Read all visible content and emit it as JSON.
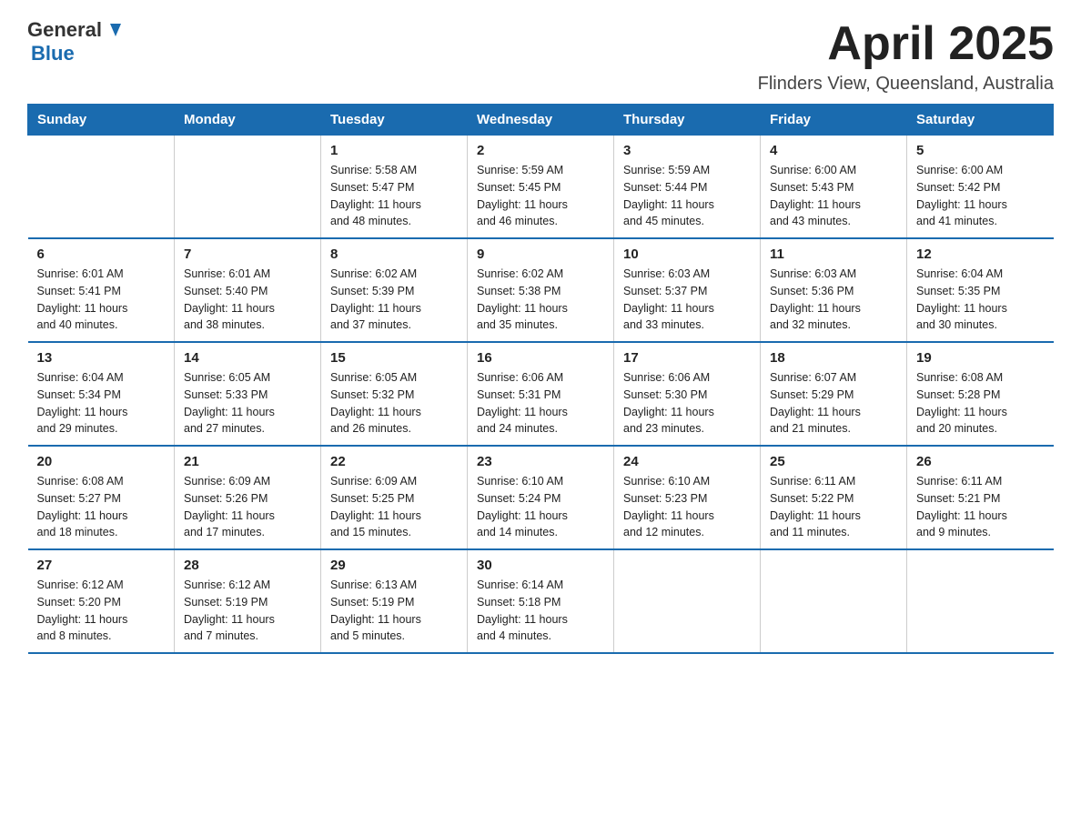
{
  "header": {
    "logo_general": "General",
    "logo_blue": "Blue",
    "month_title": "April 2025",
    "location": "Flinders View, Queensland, Australia"
  },
  "weekdays": [
    "Sunday",
    "Monday",
    "Tuesday",
    "Wednesday",
    "Thursday",
    "Friday",
    "Saturday"
  ],
  "weeks": [
    [
      {
        "day": "",
        "info": ""
      },
      {
        "day": "",
        "info": ""
      },
      {
        "day": "1",
        "info": "Sunrise: 5:58 AM\nSunset: 5:47 PM\nDaylight: 11 hours\nand 48 minutes."
      },
      {
        "day": "2",
        "info": "Sunrise: 5:59 AM\nSunset: 5:45 PM\nDaylight: 11 hours\nand 46 minutes."
      },
      {
        "day": "3",
        "info": "Sunrise: 5:59 AM\nSunset: 5:44 PM\nDaylight: 11 hours\nand 45 minutes."
      },
      {
        "day": "4",
        "info": "Sunrise: 6:00 AM\nSunset: 5:43 PM\nDaylight: 11 hours\nand 43 minutes."
      },
      {
        "day": "5",
        "info": "Sunrise: 6:00 AM\nSunset: 5:42 PM\nDaylight: 11 hours\nand 41 minutes."
      }
    ],
    [
      {
        "day": "6",
        "info": "Sunrise: 6:01 AM\nSunset: 5:41 PM\nDaylight: 11 hours\nand 40 minutes."
      },
      {
        "day": "7",
        "info": "Sunrise: 6:01 AM\nSunset: 5:40 PM\nDaylight: 11 hours\nand 38 minutes."
      },
      {
        "day": "8",
        "info": "Sunrise: 6:02 AM\nSunset: 5:39 PM\nDaylight: 11 hours\nand 37 minutes."
      },
      {
        "day": "9",
        "info": "Sunrise: 6:02 AM\nSunset: 5:38 PM\nDaylight: 11 hours\nand 35 minutes."
      },
      {
        "day": "10",
        "info": "Sunrise: 6:03 AM\nSunset: 5:37 PM\nDaylight: 11 hours\nand 33 minutes."
      },
      {
        "day": "11",
        "info": "Sunrise: 6:03 AM\nSunset: 5:36 PM\nDaylight: 11 hours\nand 32 minutes."
      },
      {
        "day": "12",
        "info": "Sunrise: 6:04 AM\nSunset: 5:35 PM\nDaylight: 11 hours\nand 30 minutes."
      }
    ],
    [
      {
        "day": "13",
        "info": "Sunrise: 6:04 AM\nSunset: 5:34 PM\nDaylight: 11 hours\nand 29 minutes."
      },
      {
        "day": "14",
        "info": "Sunrise: 6:05 AM\nSunset: 5:33 PM\nDaylight: 11 hours\nand 27 minutes."
      },
      {
        "day": "15",
        "info": "Sunrise: 6:05 AM\nSunset: 5:32 PM\nDaylight: 11 hours\nand 26 minutes."
      },
      {
        "day": "16",
        "info": "Sunrise: 6:06 AM\nSunset: 5:31 PM\nDaylight: 11 hours\nand 24 minutes."
      },
      {
        "day": "17",
        "info": "Sunrise: 6:06 AM\nSunset: 5:30 PM\nDaylight: 11 hours\nand 23 minutes."
      },
      {
        "day": "18",
        "info": "Sunrise: 6:07 AM\nSunset: 5:29 PM\nDaylight: 11 hours\nand 21 minutes."
      },
      {
        "day": "19",
        "info": "Sunrise: 6:08 AM\nSunset: 5:28 PM\nDaylight: 11 hours\nand 20 minutes."
      }
    ],
    [
      {
        "day": "20",
        "info": "Sunrise: 6:08 AM\nSunset: 5:27 PM\nDaylight: 11 hours\nand 18 minutes."
      },
      {
        "day": "21",
        "info": "Sunrise: 6:09 AM\nSunset: 5:26 PM\nDaylight: 11 hours\nand 17 minutes."
      },
      {
        "day": "22",
        "info": "Sunrise: 6:09 AM\nSunset: 5:25 PM\nDaylight: 11 hours\nand 15 minutes."
      },
      {
        "day": "23",
        "info": "Sunrise: 6:10 AM\nSunset: 5:24 PM\nDaylight: 11 hours\nand 14 minutes."
      },
      {
        "day": "24",
        "info": "Sunrise: 6:10 AM\nSunset: 5:23 PM\nDaylight: 11 hours\nand 12 minutes."
      },
      {
        "day": "25",
        "info": "Sunrise: 6:11 AM\nSunset: 5:22 PM\nDaylight: 11 hours\nand 11 minutes."
      },
      {
        "day": "26",
        "info": "Sunrise: 6:11 AM\nSunset: 5:21 PM\nDaylight: 11 hours\nand 9 minutes."
      }
    ],
    [
      {
        "day": "27",
        "info": "Sunrise: 6:12 AM\nSunset: 5:20 PM\nDaylight: 11 hours\nand 8 minutes."
      },
      {
        "day": "28",
        "info": "Sunrise: 6:12 AM\nSunset: 5:19 PM\nDaylight: 11 hours\nand 7 minutes."
      },
      {
        "day": "29",
        "info": "Sunrise: 6:13 AM\nSunset: 5:19 PM\nDaylight: 11 hours\nand 5 minutes."
      },
      {
        "day": "30",
        "info": "Sunrise: 6:14 AM\nSunset: 5:18 PM\nDaylight: 11 hours\nand 4 minutes."
      },
      {
        "day": "",
        "info": ""
      },
      {
        "day": "",
        "info": ""
      },
      {
        "day": "",
        "info": ""
      }
    ]
  ]
}
